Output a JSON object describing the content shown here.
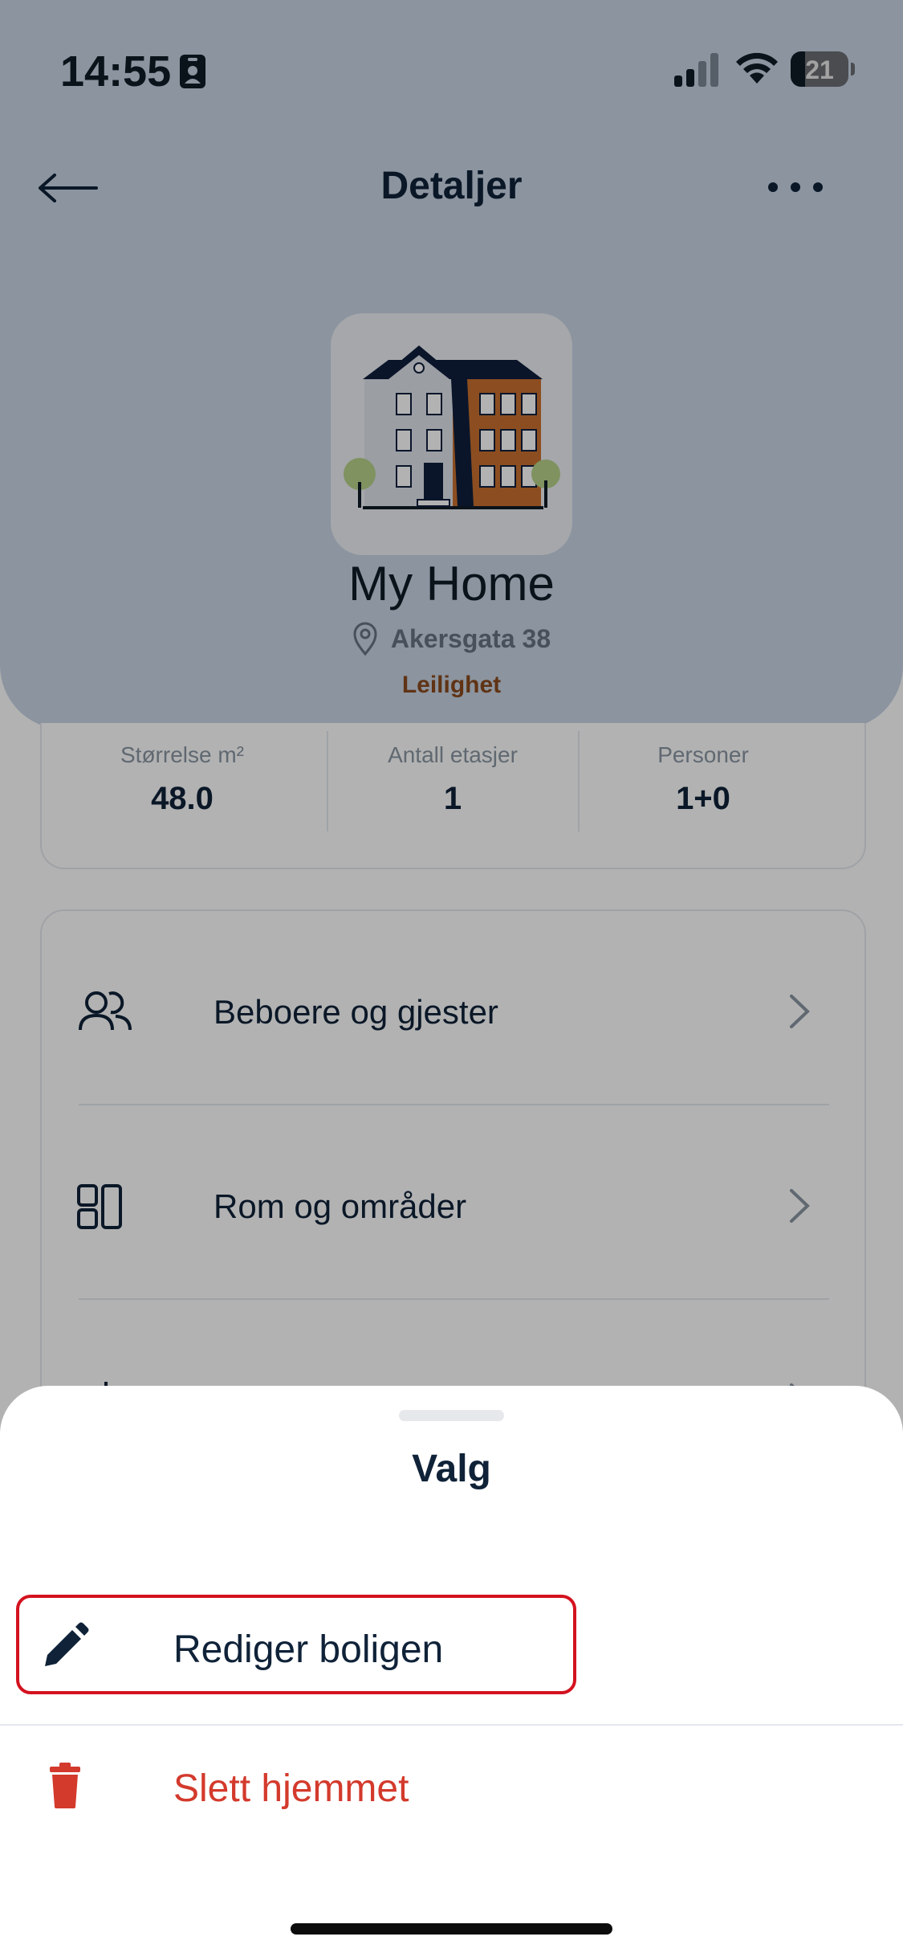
{
  "status_bar": {
    "time": "14:55",
    "battery": "21"
  },
  "nav": {
    "title": "Detaljer"
  },
  "home": {
    "name": "My Home",
    "address": "Akersgata 38",
    "type": "Leilighet"
  },
  "stats": [
    {
      "label": "Størrelse m²",
      "value": "48.0"
    },
    {
      "label": "Antall etasjer",
      "value": "1"
    },
    {
      "label": "Personer",
      "value": "1+0"
    }
  ],
  "menu": {
    "items": [
      {
        "label": "Beboere og gjester",
        "icon": "people-icon"
      },
      {
        "label": "Rom og områder",
        "icon": "rooms-icon"
      },
      {
        "label": "",
        "icon": "settings-icon"
      }
    ]
  },
  "sheet": {
    "title": "Valg",
    "options": [
      {
        "label": "Rediger boligen",
        "icon": "pencil-icon"
      },
      {
        "label": "Slett hjemmet",
        "icon": "trash-icon",
        "color": "#d33a2c"
      }
    ]
  },
  "colors": {
    "header_bg": "#c8d5e4",
    "accent_dark": "#0f2238",
    "danger": "#d33a2c",
    "type_label": "#8a4a1e"
  }
}
